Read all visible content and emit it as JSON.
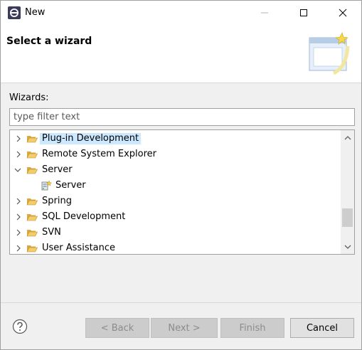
{
  "window": {
    "title": "New"
  },
  "banner": {
    "title": "Select a wizard"
  },
  "wizards": {
    "label": "Wizards:",
    "filter_placeholder": "type filter text",
    "items": [
      {
        "label": "Plug-in Development",
        "type": "folder",
        "expanded": false,
        "selected": true
      },
      {
        "label": "Remote System Explorer",
        "type": "folder",
        "expanded": false
      },
      {
        "label": "Server",
        "type": "folder",
        "expanded": true
      },
      {
        "label": "Server",
        "type": "wizard"
      },
      {
        "label": "Spring",
        "type": "folder",
        "expanded": false
      },
      {
        "label": "SQL Development",
        "type": "folder",
        "expanded": false
      },
      {
        "label": "SVN",
        "type": "folder",
        "expanded": false
      },
      {
        "label": "User Assistance",
        "type": "folder",
        "expanded": false
      }
    ]
  },
  "buttons": {
    "back": "< Back",
    "next": "Next >",
    "finish": "Finish",
    "cancel": "Cancel"
  },
  "colors": {
    "selection": "#cce8ff",
    "folder": "#e8b84a",
    "accent": "#0078d7"
  }
}
